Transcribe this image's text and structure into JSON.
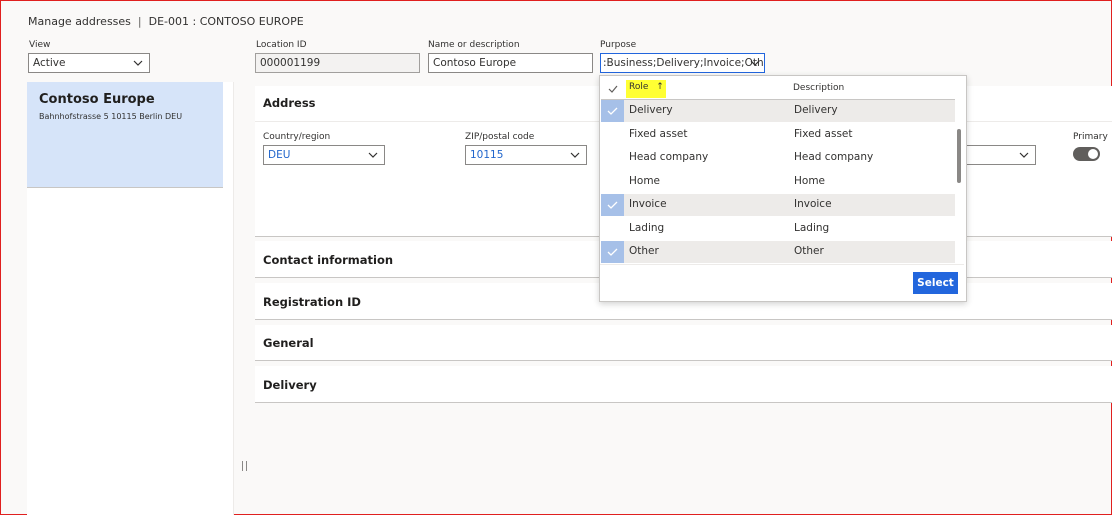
{
  "breadcrumb": {
    "page": "Manage addresses",
    "record": "DE-001 : CONTOSO EUROPE"
  },
  "filters": {
    "view_label": "View",
    "view_value": "Active",
    "location_id_label": "Location ID",
    "location_id_value": "000001199",
    "name_label": "Name or description",
    "name_value": "Contoso Europe",
    "purpose_label": "Purpose",
    "purpose_value": ":Business;Delivery;Invoice;Other"
  },
  "address_card": {
    "title": "Contoso Europe",
    "subtitle": "Bahnhofstrasse 5 10115 Berlin DEU"
  },
  "sections": {
    "address": "Address",
    "contact": "Contact information",
    "registration": "Registration ID",
    "general": "General",
    "delivery": "Delivery"
  },
  "address_fields": {
    "country_label": "Country/region",
    "country_value": "DEU",
    "zip_label": "ZIP/postal code",
    "zip_value": "10115",
    "primary_label": "Primary"
  },
  "purpose_dropdown": {
    "col_role": "Role",
    "col_description": "Description",
    "rows": [
      {
        "role": "Delivery",
        "description": "Delivery",
        "selected": true
      },
      {
        "role": "Fixed asset",
        "description": "Fixed asset",
        "selected": false
      },
      {
        "role": "Head company",
        "description": "Head company",
        "selected": false
      },
      {
        "role": "Home",
        "description": "Home",
        "selected": false
      },
      {
        "role": "Invoice",
        "description": "Invoice",
        "selected": true
      },
      {
        "role": "Lading",
        "description": "Lading",
        "selected": false
      },
      {
        "role": "Other",
        "description": "Other",
        "selected": true
      }
    ],
    "select_label": "Select"
  },
  "colors": {
    "accent": "#2266dd",
    "card_bg": "#d6e4f9",
    "highlight": "#ffff33",
    "link": "#2266cc"
  }
}
